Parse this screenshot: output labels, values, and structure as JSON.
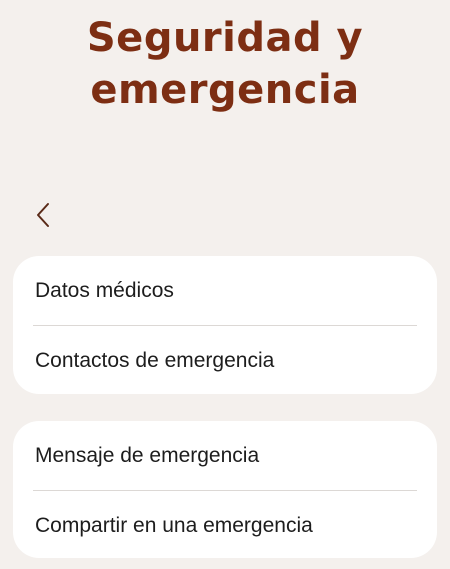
{
  "header": {
    "title_line1": "Seguridad y",
    "title_line2": "emergencia"
  },
  "navigation": {
    "back_icon": "chevron-left-icon"
  },
  "colors": {
    "background": "#f4f0ed",
    "title": "#7d2e13",
    "card": "#ffffff",
    "text": "#1d1d1d",
    "divider": "#dcd8d5"
  },
  "groups": [
    {
      "items": [
        {
          "label": "Datos médicos"
        },
        {
          "label": "Contactos de emergencia"
        }
      ]
    },
    {
      "items": [
        {
          "label": "Mensaje de emergencia"
        },
        {
          "label": "Compartir en una emergencia"
        }
      ]
    }
  ]
}
